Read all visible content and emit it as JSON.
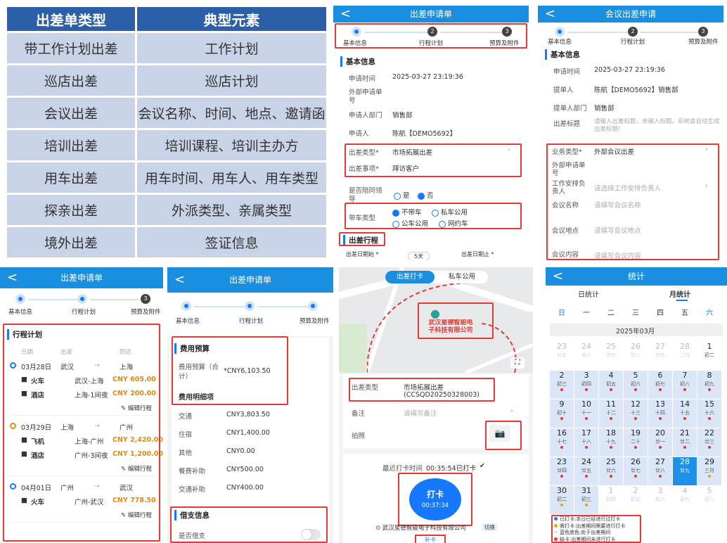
{
  "table": {
    "headers": [
      "出差单类型",
      "典型元素"
    ],
    "rows": [
      [
        "带工作计划出差",
        "工作计划"
      ],
      [
        "巡店出差",
        "巡店计划"
      ],
      [
        "会议出差",
        "会议名称、时间、地点、邀请函"
      ],
      [
        "培训出差",
        "培训课程、培训主办方"
      ],
      [
        "用车出差",
        "用车时间、用车人、用车类型"
      ],
      [
        "探亲出差",
        "外派类型、亲属类型"
      ],
      [
        "境外出差",
        "签证信息"
      ]
    ]
  },
  "p1": {
    "title": "出差申请单",
    "back": "<",
    "steps": [
      "基本信息",
      "行程计划",
      "预算及附件"
    ],
    "step_nums": [
      "2",
      "3"
    ],
    "section": "基本信息",
    "f_time_l": "申请时间",
    "f_time_v": "2025-03-27 23:19:36",
    "f_ext_l": "外部申请单号",
    "f_dept_l": "申请人部门",
    "f_dept_v": "销售部",
    "f_user_l": "申请人",
    "f_user_v": "陈航【DEMO5692】",
    "f_type_l": "出差类型*",
    "f_type_v": "市场拓展出差",
    "f_item_l": "出差事项*",
    "f_item_v": "拜访客户",
    "f_acc_l": "是否陪同领导",
    "f_yes": "是",
    "f_no": "否",
    "f_car_l": "带车类型",
    "car_opts": [
      "不带车",
      "私车公用",
      "公车公用",
      "网约车"
    ],
    "section2": "出差行程",
    "start_l": "出差日期始 *",
    "days": "5天",
    "end_l": "出差日期止 *"
  },
  "p2": {
    "title": "会议出差申请",
    "steps": [
      "基本信息",
      "行程计划",
      "预算及附件"
    ],
    "section": "基本信息",
    "f_time_l": "申请时间",
    "f_time_v": "2025-03-27 23:19:36",
    "f_user_l": "提单人",
    "f_user_v": "陈航【DEMO5692】销售部",
    "f_dept_l": "提单人部门",
    "f_dept_v": "销售部",
    "f_title_l": "出差标题",
    "f_title_ph": "请输入出差标题，未输入标题，系统会自动生成出差标题!",
    "f_biz_l": "业务类型*",
    "f_biz_v": "外部会议出差",
    "f_ext_l": "外部申请单号",
    "f_arr_l": "工作安排负责人",
    "f_arr_ph": "请选择工作安排负责人",
    "f_name_l": "会议名称",
    "f_name_ph": "请填写会议名称",
    "f_loc_l": "会议地点",
    "f_loc_ph": "请填写会议地点",
    "f_cont_l": "会议内容",
    "f_cont_ph": "请填写会议内容"
  },
  "p3": {
    "title": "出差申请单",
    "steps": [
      "基本信息",
      "行程计划",
      "预算及附件"
    ],
    "section": "行程计划",
    "cols": [
      "日期",
      "出发",
      "到达"
    ],
    "trips": [
      {
        "date": "03月28日",
        "from": "武汉",
        "to": "上海",
        "items": [
          {
            "t": "火车",
            "r": "武汉-上海",
            "p": "CNY 605.00"
          },
          {
            "t": "酒店",
            "r": "上海-1间夜",
            "p": "CNY 200.00"
          }
        ]
      },
      {
        "date": "03月29日",
        "from": "上海",
        "to": "广州",
        "items": [
          {
            "t": "飞机",
            "r": "上海-广州",
            "p": "CNY 2,420.00"
          },
          {
            "t": "酒店",
            "r": "广州-3间夜",
            "p": "CNY 1,200.00"
          }
        ]
      },
      {
        "date": "04月01日",
        "from": "广州",
        "to": "武汉",
        "items": [
          {
            "t": "火车",
            "r": "广州-武汉",
            "p": "CNY 778.50"
          }
        ]
      }
    ],
    "edit": "编辑行程"
  },
  "p4": {
    "title": "出差申请单",
    "steps": [
      "基本信息",
      "行程计划",
      "预算及附件"
    ],
    "sec1": "费用预算",
    "budget_l": "费用预算（合计）",
    "budget_v": "*CNY6,103.50",
    "sec2": "费用明细项",
    "items": [
      [
        "交通",
        "CNY3,803.50"
      ],
      [
        "住宿",
        "CNY1,400.00"
      ],
      [
        "其他",
        "CNY0.00"
      ],
      [
        "餐费补助",
        "CNY500.00"
      ],
      [
        "交通补助",
        "CNY400.00"
      ]
    ],
    "sec3": "借支信息",
    "loan_l": "是否借支"
  },
  "p5": {
    "tab1": "出差打卡",
    "tab2": "私车公用",
    "map_label": "武汉星德智能电子科技有限公司",
    "type_l": "出差类型",
    "type_v": "市场拓展出差",
    "type_code": "(CCSQD20250328003)",
    "memo_l": "备注",
    "memo_ph": "请填写备注",
    "photo_l": "拍照",
    "last": "最近打卡时间",
    "last_v": "00:35:54已打卡",
    "btn": "打卡",
    "btn_time": "00:37:34",
    "loc": "武汉星德智能电子科技有限公司",
    "switch": "切换",
    "bottom": "补卡"
  },
  "p6": {
    "title": "统计",
    "tab1": "日统计",
    "tab2": "月统计",
    "weekdays": [
      "日",
      "一",
      "二",
      "三",
      "四",
      "五",
      "六"
    ],
    "month": "2025年03月",
    "cells": [
      [
        "23",
        "廿五"
      ],
      [
        "24",
        "廿六"
      ],
      [
        "25",
        "廿七"
      ],
      [
        "26",
        "廿八"
      ],
      [
        "27",
        "廿九"
      ],
      [
        "28",
        "二月"
      ],
      [
        "1",
        "初二"
      ],
      [
        "2",
        "初三"
      ],
      [
        "3",
        "初四"
      ],
      [
        "4",
        "初五"
      ],
      [
        "5",
        "初六"
      ],
      [
        "6",
        "初七"
      ],
      [
        "7",
        "初八"
      ],
      [
        "8",
        "初九"
      ],
      [
        "9",
        "初十"
      ],
      [
        "10",
        "十一"
      ],
      [
        "11",
        "十二"
      ],
      [
        "12",
        "十三"
      ],
      [
        "13",
        "十四"
      ],
      [
        "14",
        "十五"
      ],
      [
        "15",
        "十六"
      ],
      [
        "16",
        "十七"
      ],
      [
        "17",
        "十八"
      ],
      [
        "18",
        "十九"
      ],
      [
        "19",
        "二十"
      ],
      [
        "20",
        "廿一"
      ],
      [
        "21",
        "廿二"
      ],
      [
        "22",
        "廿三"
      ],
      [
        "23",
        "廿四"
      ],
      [
        "24",
        "廿五"
      ],
      [
        "25",
        "廿六"
      ],
      [
        "26",
        "廿七"
      ],
      [
        "27",
        "廿八"
      ],
      [
        "28",
        "廿九"
      ],
      [
        "29",
        "三月"
      ],
      [
        "30",
        "初二"
      ],
      [
        "31",
        "初三"
      ],
      [
        "1",
        "初四"
      ],
      [
        "2",
        "初五"
      ],
      [
        "3",
        "初六"
      ],
      [
        "4",
        "初七"
      ],
      [
        "5",
        "初八"
      ]
    ],
    "legend": [
      "已打卡:本日已经进行过打卡",
      "需打卡:出差期间需要进行打卡",
      "蓝色底色:处于出差期间",
      "缺卡:出差期间未进行打卡"
    ]
  },
  "colors": {
    "accent": "#1677ff",
    "bar": "#1a8fe0",
    "red": "#e53935",
    "orange": "#e8890a",
    "header": "#2d5ea8",
    "cell": "#c9d3e8"
  }
}
